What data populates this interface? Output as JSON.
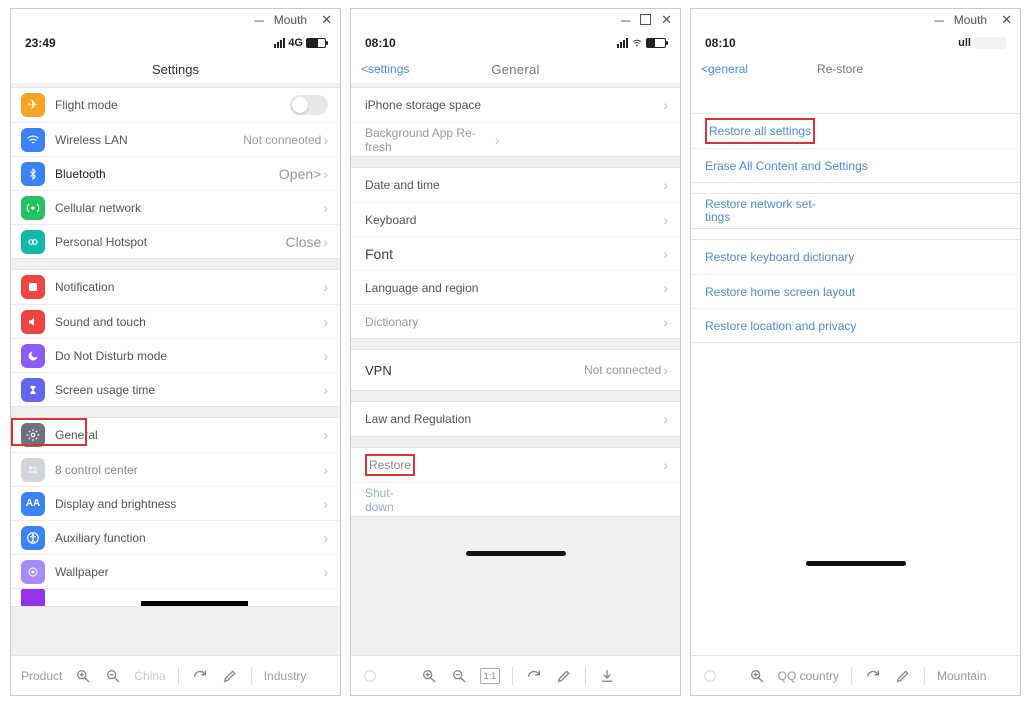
{
  "win1": {
    "title": "Mouth"
  },
  "win2": {
    "title": ""
  },
  "win3": {
    "title": "Mouth"
  },
  "screen1": {
    "time": "23:49",
    "net": "4G",
    "header": "Settings",
    "g1": {
      "flight": "Flight mode",
      "wlan": "Wireless LAN",
      "wlan_meta": "Not conneoted",
      "bt": "Bluetooth",
      "bt_meta": "Open>",
      "cell": "Cellular network",
      "hotspot": "Personal Hotspot",
      "hotspot_meta": "Close"
    },
    "g2": {
      "notif": "Notification",
      "sound": "Sound and touch",
      "dnd": "Do Not Disturb mode",
      "screentime": "Screen usage time"
    },
    "g3": {
      "general": "General",
      "control": "8 control center",
      "display": "Display and brightness",
      "aux": "Auxiliary function",
      "wallpaper": "Wallpaper"
    }
  },
  "screen2": {
    "time": "08:10",
    "back": "<settings",
    "title": "General",
    "g1": {
      "storage": "iPhone storage space",
      "bg": "Background App Re-fresh"
    },
    "g2": {
      "date": "Date and time",
      "kb": "Keyboard",
      "font": "Font",
      "lang": "Language and region",
      "dict": "Dictionary"
    },
    "g3": {
      "vpn": "VPN",
      "vpn_meta": "Not connected"
    },
    "g4": {
      "law": "Law and Regulation"
    },
    "g5": {
      "restore": "Restore",
      "shut": "Shut-down"
    }
  },
  "screen3": {
    "time": "08:10",
    "net": "ull",
    "back": "<general",
    "title": "Re-store",
    "g1": {
      "a": "Restore all settings",
      "b": "Erase All Content and Settings"
    },
    "g2": {
      "a": "Restore network set-tings"
    },
    "g3": {
      "a": "Restore keyboard dictionary",
      "b": "Restore home screen layout",
      "c": "Restore location and privacy"
    }
  },
  "tb1": {
    "left": "Product",
    "mid": "China",
    "right": "Industry"
  },
  "tb2": {
    "mid": "1:1"
  },
  "tb3": {
    "mid": "QQ country",
    "right": "Mountain"
  }
}
